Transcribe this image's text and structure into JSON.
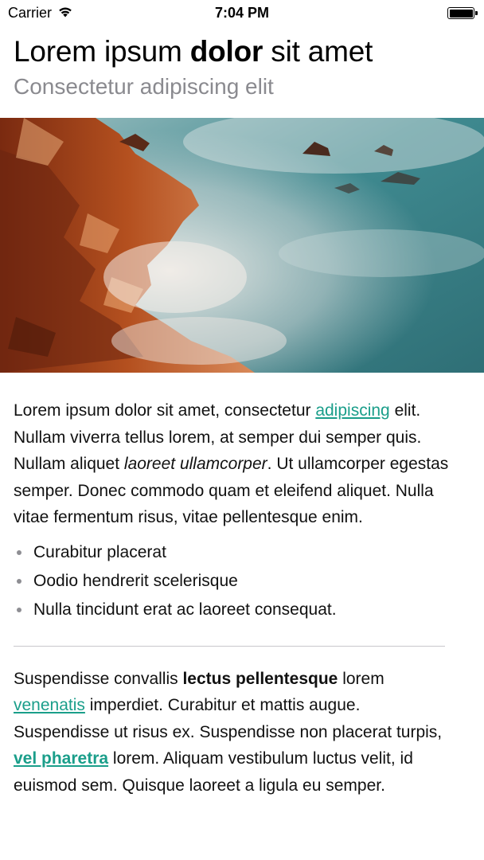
{
  "status_bar": {
    "carrier": "Carrier",
    "time": "7:04 PM",
    "wifi_icon": "wifi-icon",
    "battery_icon": "battery-icon"
  },
  "header": {
    "title_pre": "Lorem ipsum ",
    "title_bold": "dolor",
    "title_post": " sit amet",
    "subtitle": "Consectetur adipiscing elit"
  },
  "hero": {
    "subject": "rocky coastline with misty sea"
  },
  "paragraph1": {
    "t1": "Lorem ipsum dolor sit amet, consectetur ",
    "link": "adipiscing",
    "t2": " elit. Nullam viverra tellus lorem, at semper dui semper quis. Nullam aliquet ",
    "italic": "laoreet ullamcorper",
    "t3": ". Ut ullamcorper egestas semper. Donec commodo quam et eleifend aliquet. Nulla vitae fermentum risus, vitae pellentesque enim."
  },
  "bullets": [
    "Curabitur placerat",
    "Oodio hendrerit scelerisque",
    "Nulla tincidunt erat ac laoreet consequat."
  ],
  "paragraph2": {
    "t1": "Suspendisse convallis ",
    "bold": "lectus pellentesque",
    "t2": " lorem ",
    "link1": "venenatis",
    "t3": " imperdiet. Curabitur et mattis augue. Suspendisse ut risus ex. Suspendisse non placerat turpis, ",
    "link2": "vel pharetra",
    "t4": " lorem. Aliquam vestibulum luctus velit, id euismod sem. Quisque laoreet a ligula eu semper."
  },
  "colors": {
    "link": "#1a9e8a",
    "subtitle": "#8a8a8f"
  }
}
